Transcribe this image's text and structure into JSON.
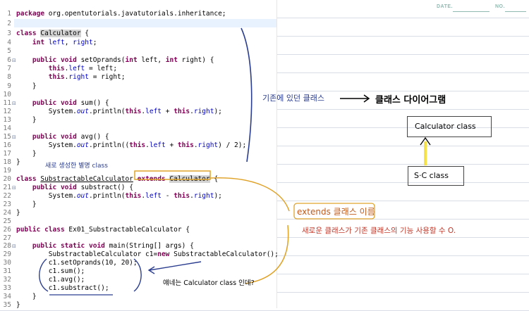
{
  "header": {
    "date_label": "DATE.",
    "no_label": "NO."
  },
  "editor": {
    "line_numbers": [
      "1",
      "2",
      "3",
      "4",
      "5",
      "6",
      "7",
      "8",
      "9",
      "10",
      "11",
      "12",
      "13",
      "14",
      "15",
      "16",
      "17",
      "18",
      "19",
      "20",
      "21",
      "22",
      "23",
      "24",
      "25",
      "26",
      "27",
      "28",
      "29",
      "30",
      "31",
      "32",
      "33",
      "34",
      "35"
    ],
    "lines": [
      [
        "package org.opentutorials.javatutorials.inheritance;"
      ],
      [
        ""
      ],
      [
        "class Calculator {"
      ],
      [
        "    int left, right;"
      ],
      [
        ""
      ],
      [
        "    public void setOprands(int left, int right) {"
      ],
      [
        "        this.left = left;"
      ],
      [
        "        this.right = right;"
      ],
      [
        "    }"
      ],
      [
        ""
      ],
      [
        "    public void sum() {"
      ],
      [
        "        System.out.println(this.left + this.right);"
      ],
      [
        "    }"
      ],
      [
        ""
      ],
      [
        "    public void avg() {"
      ],
      [
        "        System.out.println((this.left + this.right) / 2);"
      ],
      [
        "    }"
      ],
      [
        "}"
      ],
      [
        ""
      ],
      [
        "class SubstractableCalculator extends Calculator {"
      ],
      [
        "    public void substract() {"
      ],
      [
        "        System.out.println(this.left - this.right);"
      ],
      [
        "    }"
      ],
      [
        "}"
      ],
      [
        ""
      ],
      [
        "public class Ex01_SubstractableCalculator {"
      ],
      [
        ""
      ],
      [
        "    public static void main(String[] args) {"
      ],
      [
        "        SubstractableCalculator c1=new SubstractableCalculator();"
      ],
      [
        "        c1.setOprands(10, 20);"
      ],
      [
        "        c1.sum();"
      ],
      [
        "        c1.avg();"
      ],
      [
        "        c1.substract();"
      ],
      [
        "    }"
      ],
      [
        "}"
      ]
    ]
  },
  "annotations": {
    "existing_class": "기존에 있던 클래스",
    "class_diagram": "클래스 다이어그램",
    "new_class": "새로 생성한 별명 class",
    "extends_label": "extends 클래스 이름",
    "extends_desc": "새로운 클래스가 기존 클래스의 기능 사용할 수 O.",
    "question": "얘네는 Calculator class 인데?",
    "diagram_parent": "Calculator class",
    "diagram_child": "S·C class"
  },
  "colors": {
    "keyword": "#7f0055",
    "field": "#0000c0",
    "ink_blue": "#2b3d8f",
    "ink_orange": "#e0a32a",
    "ink_red": "#c0392b",
    "header_teal": "#8fb9b0",
    "diagram_arrow": "#f5e14a"
  }
}
